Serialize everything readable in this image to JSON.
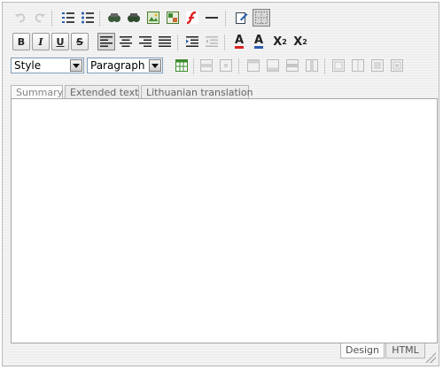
{
  "toolbar": {
    "format_select": {
      "value": "Style"
    },
    "block_select": {
      "value": "Paragraph"
    },
    "bold_label": "B",
    "italic_label": "I",
    "underline_label": "U",
    "strike_label": "S",
    "superscript_label": "X",
    "superscript_mark": "2",
    "subscript_label": "X",
    "subscript_mark": "2",
    "forecolor_label": "A",
    "backcolor_label": "A"
  },
  "tabs": [
    {
      "label": "Summary"
    },
    {
      "label": "Extended text"
    },
    {
      "label": "Lithuanian translation"
    }
  ],
  "bottom_tabs": [
    {
      "label": "Design"
    },
    {
      "label": "HTML"
    }
  ]
}
